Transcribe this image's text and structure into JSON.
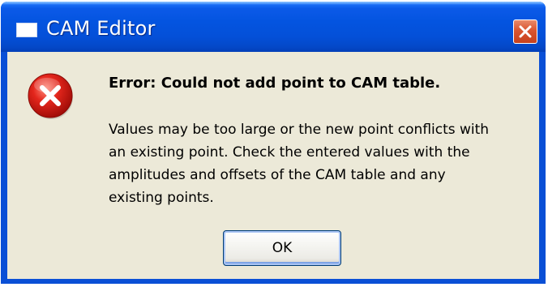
{
  "window": {
    "title": "CAM Editor",
    "title_icon": "window-app-icon",
    "close_icon": "close-icon",
    "colors": {
      "titlebar": "#0454e0",
      "close_button": "#d9542f",
      "client_background": "#ece9d8"
    }
  },
  "dialog": {
    "icon": "error-icon",
    "heading": "Error: Could not add point to CAM table.",
    "message_lines": [
      "Values may be too large or the new point conflicts with",
      "an existing point. Check the entered values with the",
      "amplitudes and offsets of the CAM table and any",
      "existing points."
    ],
    "ok_label": "OK"
  }
}
